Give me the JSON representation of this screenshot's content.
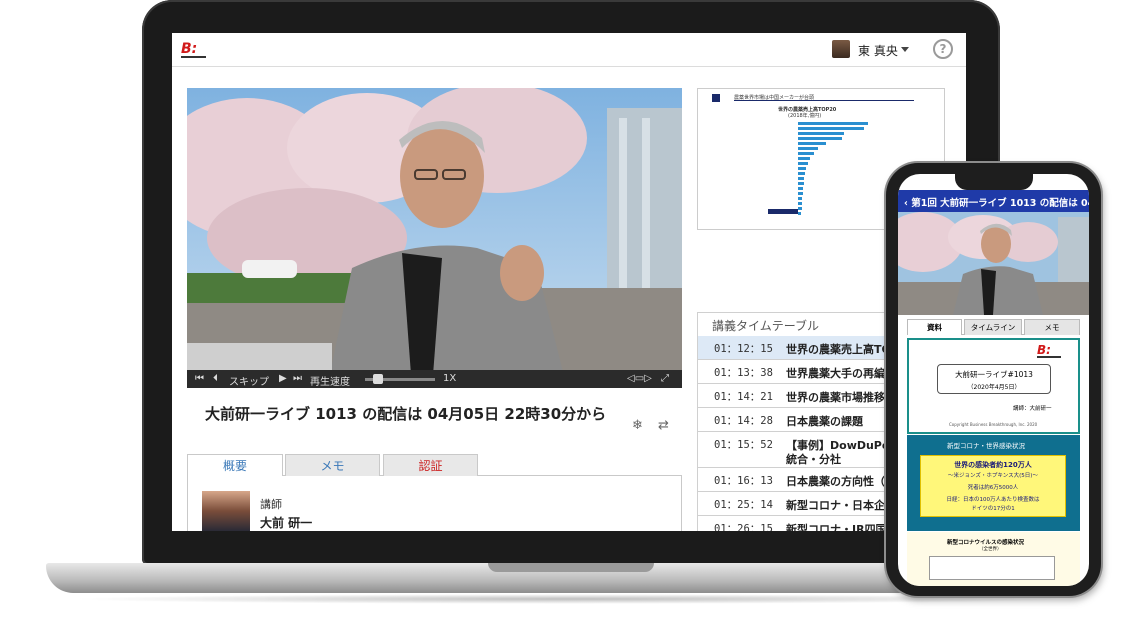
{
  "laptop": {
    "header": {
      "user_name": "東 真央",
      "help_label": "?"
    },
    "video": {
      "controls": {
        "skip_label": "スキップ",
        "speed_label": "再生速度",
        "speed_value": "1X"
      }
    },
    "title": "大前研一ライブ 1013 の配信は 04月05日 22時30分から",
    "tabs": [
      {
        "label": "概要",
        "color": "#3a78b8"
      },
      {
        "label": "メモ",
        "color": "#3a78b8"
      },
      {
        "label": "認証",
        "color": "#cc2222"
      }
    ],
    "lecturer": {
      "role": "講師",
      "name": "大前 研一"
    },
    "slide": {
      "header": "農薬世界市場は中国メーカーが台頭",
      "chart_title": "世界の農薬売上高TOP20",
      "chart_subtitle": "(2018年,億円)"
    },
    "timetable": {
      "heading": "講義タイムテーブル",
      "rows": [
        {
          "time": "01：12：15",
          "label": "世界の農薬売上高TOP"
        },
        {
          "time": "01：13：38",
          "label": "世界農薬大手の再編経"
        },
        {
          "time": "01：14：21",
          "label": "世界の農薬市場推移"
        },
        {
          "time": "01：14：28",
          "label": "日本農薬の課題"
        },
        {
          "time": "01：15：52",
          "label": "【事例】DowDuPont",
          "label2": "統合・分社"
        },
        {
          "time": "01：16：13",
          "label": "日本農薬の方向性（案"
        },
        {
          "time": "01：25：14",
          "label": "新型コロナ・日本企業"
        },
        {
          "time": "01：26：15",
          "label": "新型コロナ・JR四国"
        }
      ]
    }
  },
  "phone": {
    "title_bar": "第1回 大前研一ライブ 1013 の配信は 04月...",
    "tabs": [
      {
        "label": "資料"
      },
      {
        "label": "タイムライン"
      },
      {
        "label": "メモ"
      }
    ],
    "slide1": {
      "title": "大前研一ライブ#1013",
      "date": "（2020年4月5日）",
      "lecturer": "講師：大前研一",
      "copyright": "Copyright Business Breakthrough, Inc. 2020"
    },
    "slide2": {
      "header": "新型コロナ・世界感染状況",
      "line1": "世界の感染者約120万人",
      "line2": "～米ジョンズ・ホプキンス大(5日)～",
      "line3": "死者は約6万5000人",
      "line4": "日経：日本の100万人あたり検査数は",
      "line5": "ドイツの17分の1"
    },
    "slide3": {
      "title": "新型コロナウイルスの感染状況",
      "sub": "（全世界）"
    }
  }
}
